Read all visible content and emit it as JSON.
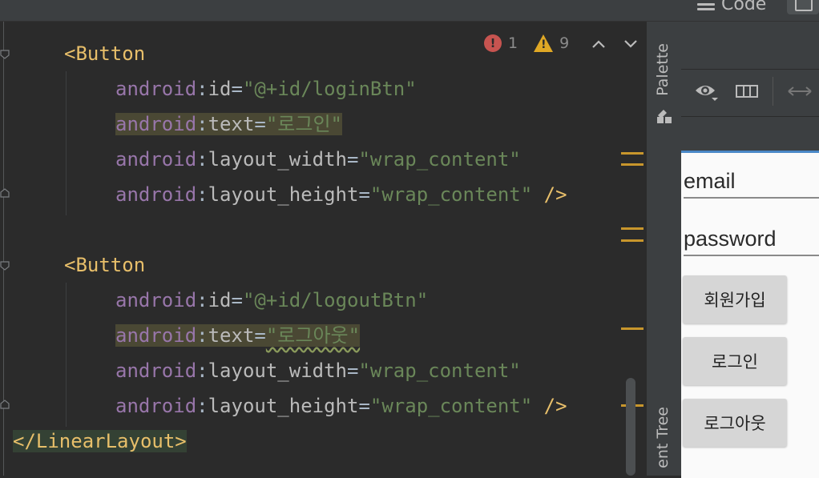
{
  "topbar": {
    "mode_label": "Code"
  },
  "inspections": {
    "errors": "1",
    "warnings": "9",
    "prev_label": "^",
    "next_label": "v"
  },
  "code": {
    "lines": [
      {
        "open": "<",
        "tag": "Button"
      },
      {
        "ns": "android",
        "attr": "id",
        "eq": "=",
        "value": "\"@+id/loginBtn\""
      },
      {
        "ns": "android",
        "attr": "text",
        "eq": "=",
        "value": "\"로그인\""
      },
      {
        "ns": "android",
        "attr": "layout_width",
        "eq": "=",
        "value": "\"wrap_content\""
      },
      {
        "ns": "android",
        "attr": "layout_height",
        "eq": "=",
        "value": "\"wrap_content\"",
        "close": " />"
      },
      {
        "open": "<",
        "tag": "Button"
      },
      {
        "ns": "android",
        "attr": "id",
        "eq": "=",
        "value": "\"@+id/logoutBtn\""
      },
      {
        "ns": "android",
        "attr": "text",
        "eq": "=",
        "value": "\"로그아웃\""
      },
      {
        "ns": "android",
        "attr": "layout_width",
        "eq": "=",
        "value": "\"wrap_content\""
      },
      {
        "ns": "android",
        "attr": "layout_height",
        "eq": "=",
        "value": "\"wrap_content\"",
        "close": " />"
      },
      {
        "end": "</LinearLayout>"
      }
    ]
  },
  "sidebar": {
    "palette_label": "Palette",
    "component_tree_label": "ent Tree"
  },
  "preview": {
    "email_field": "email",
    "password_field": "password",
    "signup_button": "회원가입",
    "login_button": "로그인",
    "logout_button": "로그아웃"
  },
  "colors": {
    "tag": "#e8bf6a",
    "attribute_namespace": "#9876aa",
    "string": "#6a8759",
    "error": "#c75450",
    "warning": "#e0a825",
    "selection_accent": "#4a88c7"
  }
}
